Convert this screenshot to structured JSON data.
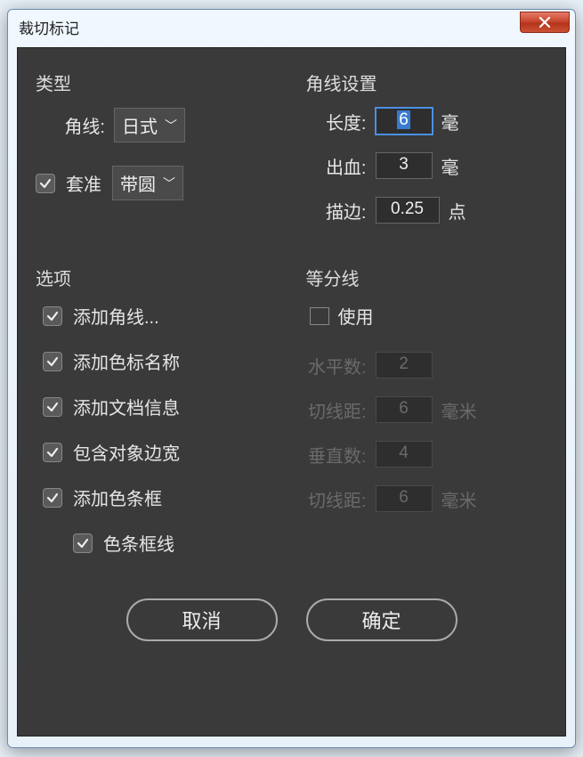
{
  "window": {
    "title": "裁切标记"
  },
  "type": {
    "groupTitle": "类型",
    "cornerLine": {
      "label": "角线:",
      "value": "日式"
    },
    "register": {
      "label": "套准",
      "value": "带圆",
      "checked": true
    }
  },
  "cornerSettings": {
    "groupTitle": "角线设置",
    "length": {
      "label": "长度:",
      "value": "6",
      "unit": "毫"
    },
    "bleed": {
      "label": "出血:",
      "value": "3",
      "unit": "毫"
    },
    "stroke": {
      "label": "描边:",
      "value": "0.25",
      "unit": "点"
    }
  },
  "options": {
    "groupTitle": "选项",
    "items": [
      {
        "label": "添加角线...",
        "checked": true
      },
      {
        "label": "添加色标名称",
        "checked": true
      },
      {
        "label": "添加文档信息",
        "checked": true
      },
      {
        "label": "包含对象边宽",
        "checked": true
      },
      {
        "label": "添加色条框",
        "checked": true
      }
    ],
    "sub": {
      "label": "色条框线",
      "checked": true
    }
  },
  "divide": {
    "groupTitle": "等分线",
    "use": {
      "label": "使用",
      "checked": false
    },
    "hCount": {
      "label": "水平数:",
      "value": "2"
    },
    "hGap": {
      "label": "切线距:",
      "value": "6",
      "unit": "毫米"
    },
    "vCount": {
      "label": "垂直数:",
      "value": "4"
    },
    "vGap": {
      "label": "切线距:",
      "value": "6",
      "unit": "毫米"
    }
  },
  "buttons": {
    "cancel": "取消",
    "ok": "确定"
  }
}
